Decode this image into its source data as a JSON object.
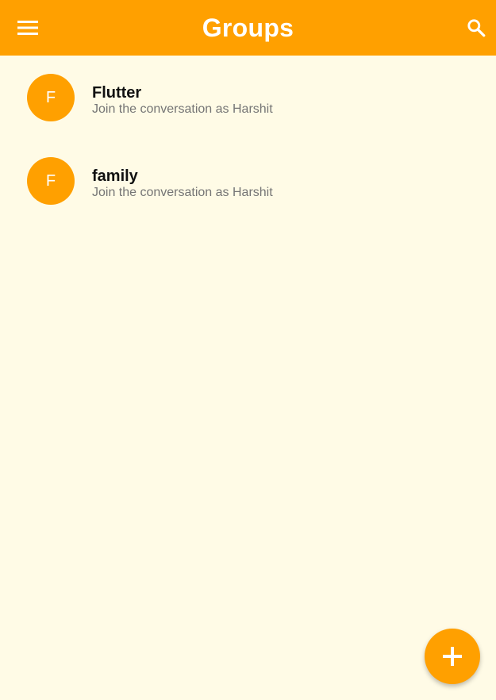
{
  "header": {
    "title": "Groups",
    "menu_icon": "menu-icon",
    "search_icon": "search-icon"
  },
  "groups": [
    {
      "initial": "F",
      "name": "Flutter",
      "subtitle": "Join the conversation as Harshit"
    },
    {
      "initial": "F",
      "name": "family",
      "subtitle": "Join the conversation as Harshit"
    }
  ],
  "fab": {
    "icon": "add-icon"
  },
  "colors": {
    "accent": "#FFA000",
    "background": "#FFFBE6",
    "on_accent": "#FFFFFF"
  }
}
